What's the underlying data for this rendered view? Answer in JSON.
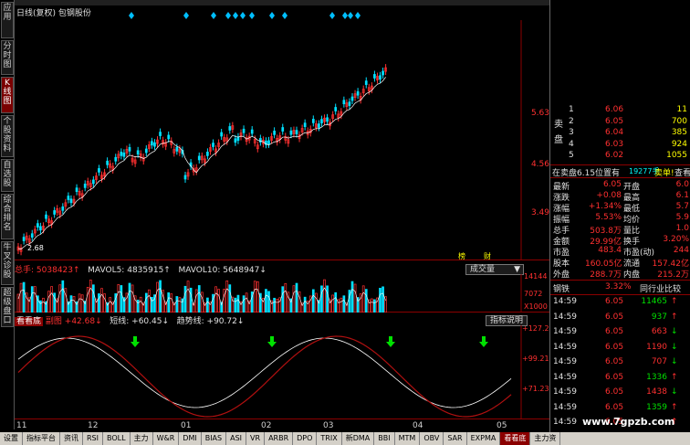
{
  "left_tabs": [
    {
      "label": "应用",
      "active": false
    },
    {
      "label": "分时图",
      "active": false
    },
    {
      "label": "K线图",
      "active": true
    },
    {
      "label": "个股资料",
      "active": false
    },
    {
      "label": "自选股",
      "active": false
    },
    {
      "label": "综合排名",
      "active": false
    },
    {
      "label": "牛叉诊股",
      "active": false
    },
    {
      "label": "超级盘口",
      "active": false
    }
  ],
  "chart": {
    "title": "日线(复权)  包钢股份",
    "price_labels": [
      "5.63",
      "4.56",
      "3.49"
    ],
    "low_marker": "2.68",
    "badges": [
      "榜",
      "财"
    ],
    "vol_button": "成交量",
    "ind_button": "指标说明"
  },
  "volume": {
    "name": "总手:",
    "value": "5038423↑",
    "ma5_label": "MAVOL5:",
    "ma5_value": "4835915↑",
    "ma10_label": "MAVOL10:",
    "ma10_value": "5648947↓",
    "labels": [
      "14144",
      "7072",
      "X1000"
    ]
  },
  "indicator": {
    "name": "看看底",
    "sub": "副图",
    "v1": "+42.68↓",
    "short_label": "短线:",
    "short_value": "+60.45↓",
    "trend_label": "趋势线:",
    "trend_value": "+90.72↓",
    "labels": [
      "+127.2",
      "+99.21",
      "+71.23"
    ]
  },
  "dates": [
    "11",
    "12",
    "01",
    "02",
    "03",
    "04",
    "05"
  ],
  "bottom_tabs": [
    {
      "label": "设置",
      "active": false
    },
    {
      "label": "指标平台",
      "active": false
    },
    {
      "label": "资讯",
      "active": false
    },
    {
      "label": "RSI",
      "active": false
    },
    {
      "label": "BOLL",
      "active": false
    },
    {
      "label": "主力",
      "active": false
    },
    {
      "label": "W&R",
      "active": false
    },
    {
      "label": "DMI",
      "active": false
    },
    {
      "label": "BIAS",
      "active": false
    },
    {
      "label": "ASI",
      "active": false
    },
    {
      "label": "VR",
      "active": false
    },
    {
      "label": "ARBR",
      "active": false
    },
    {
      "label": "DPO",
      "active": false
    },
    {
      "label": "TRIX",
      "active": false
    },
    {
      "label": "新DMA",
      "active": false
    },
    {
      "label": "BBI",
      "active": false
    },
    {
      "label": "MTM",
      "active": false
    },
    {
      "label": "OBV",
      "active": false
    },
    {
      "label": "SAR",
      "active": false
    },
    {
      "label": "EXPMA",
      "active": false
    },
    {
      "label": "看看底",
      "active": true
    },
    {
      "label": "主力资",
      "active": false
    }
  ],
  "quote": {
    "sell_label": "卖盘",
    "sells": [
      {
        "level": "1",
        "price": "6.06",
        "vol": "11"
      },
      {
        "level": "2",
        "price": "6.05",
        "vol": "700"
      },
      {
        "level": "3",
        "price": "6.04",
        "vol": "385"
      },
      {
        "level": "4",
        "price": "6.03",
        "vol": "924"
      },
      {
        "level": "5",
        "price": "6.02",
        "vol": "1055"
      }
    ],
    "notice_left": "在卖盘6.15位置有",
    "notice_mid": "19277手",
    "notice_right": "卖单!",
    "notice_link": "查看详细",
    "stats": [
      {
        "k1": "最新",
        "v1": "6.05",
        "k2": "开盘",
        "v2": "6.0"
      },
      {
        "k1": "涨跌",
        "v1": "+0.08",
        "k2": "最高",
        "v2": "6.1"
      },
      {
        "k1": "涨幅",
        "v1": "+1.34%",
        "k2": "最低",
        "v2": "5.7"
      },
      {
        "k1": "振幅",
        "v1": "5.53%",
        "k2": "均价",
        "v2": "5.9"
      },
      {
        "k1": "总手",
        "v1": "503.8万",
        "k2": "量比",
        "v2": "1.0"
      },
      {
        "k1": "金额",
        "v1": "29.99亿",
        "k2": "换手",
        "v2": "3.20%"
      },
      {
        "k1": "市盈",
        "v1": "483.4",
        "k2": "市盈(动)",
        "v2": "244"
      },
      {
        "k1": "股本",
        "v1": "160.05亿",
        "k2": "流通",
        "v2": "157.42亿"
      },
      {
        "k1": "外盘",
        "v1": "288.7万",
        "k2": "内盘",
        "v2": "215.2万"
      }
    ],
    "industry": "钢铁",
    "industry_pct": "3.32%",
    "industry_link": "同行业比较",
    "ticks": [
      {
        "time": "14:59",
        "price": "6.05",
        "vol": "11465",
        "dir": "up"
      },
      {
        "time": "14:59",
        "price": "6.05",
        "vol": "937",
        "dir": "up"
      },
      {
        "time": "14:59",
        "price": "6.05",
        "vol": "663",
        "dir": "down"
      },
      {
        "time": "14:59",
        "price": "6.05",
        "vol": "1190",
        "dir": "down"
      },
      {
        "time": "14:59",
        "price": "6.05",
        "vol": "707",
        "dir": "down"
      },
      {
        "time": "14:59",
        "price": "6.05",
        "vol": "1336",
        "dir": "up"
      },
      {
        "time": "14:59",
        "price": "6.05",
        "vol": "1438",
        "dir": "down"
      },
      {
        "time": "14:59",
        "price": "6.05",
        "vol": "1359",
        "dir": "up"
      },
      {
        "time": "14:59",
        "price": "6.05",
        "vol": "",
        "dir": "up"
      }
    ]
  },
  "watermark": "www.7gpzb.com",
  "colors": {
    "up": "#ff3030",
    "down": "#00e0ff",
    "ma": "#ffffff",
    "ind1": "#ffffff",
    "ind2": "#b01010"
  }
}
